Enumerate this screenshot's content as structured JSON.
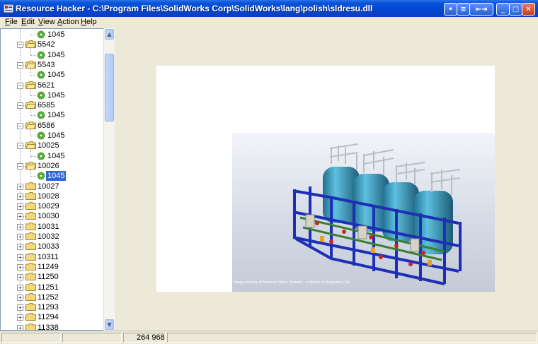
{
  "window": {
    "title": "Resource Hacker   -   C:\\Program Files\\SolidWorks Corp\\SolidWorks\\lang\\polish\\sldresu.dll"
  },
  "menu": [
    {
      "label": "File",
      "accel": "F",
      "rest": "ile"
    },
    {
      "label": "Edit",
      "accel": "E",
      "rest": "dit"
    },
    {
      "label": "View",
      "accel": "V",
      "rest": "iew"
    },
    {
      "label": "Action",
      "accel": "A",
      "rest": "ction"
    },
    {
      "label": "Help",
      "accel": "H",
      "rest": "elp"
    }
  ],
  "tree": {
    "rows": [
      {
        "type": "leaf",
        "label": "1045"
      },
      {
        "type": "folder",
        "label": "5542",
        "expanded": true
      },
      {
        "type": "leaf",
        "label": "1045"
      },
      {
        "type": "folder",
        "label": "5543",
        "expanded": true
      },
      {
        "type": "leaf",
        "label": "1045"
      },
      {
        "type": "folder",
        "label": "5621",
        "expanded": true
      },
      {
        "type": "leaf",
        "label": "1045"
      },
      {
        "type": "folder",
        "label": "6585",
        "expanded": true
      },
      {
        "type": "leaf",
        "label": "1045"
      },
      {
        "type": "folder",
        "label": "6586",
        "expanded": true
      },
      {
        "type": "leaf",
        "label": "1045"
      },
      {
        "type": "folder",
        "label": "10025",
        "expanded": true
      },
      {
        "type": "leaf",
        "label": "1045"
      },
      {
        "type": "folder",
        "label": "10026",
        "expanded": true
      },
      {
        "type": "leaf",
        "label": "1045",
        "selected": true
      },
      {
        "type": "folder",
        "label": "10027",
        "expanded": false
      },
      {
        "type": "folder",
        "label": "10028",
        "expanded": false
      },
      {
        "type": "folder",
        "label": "10029",
        "expanded": false
      },
      {
        "type": "folder",
        "label": "10030",
        "expanded": false
      },
      {
        "type": "folder",
        "label": "10031",
        "expanded": false
      },
      {
        "type": "folder",
        "label": "10032",
        "expanded": false
      },
      {
        "type": "folder",
        "label": "10033",
        "expanded": false
      },
      {
        "type": "folder",
        "label": "10311",
        "expanded": false
      },
      {
        "type": "folder",
        "label": "11249",
        "expanded": false
      },
      {
        "type": "folder",
        "label": "11250",
        "expanded": false
      },
      {
        "type": "folder",
        "label": "11251",
        "expanded": false
      },
      {
        "type": "folder",
        "label": "11252",
        "expanded": false
      },
      {
        "type": "folder",
        "label": "11293",
        "expanded": false
      },
      {
        "type": "folder",
        "label": "11294",
        "expanded": false
      },
      {
        "type": "folder",
        "label": "11338",
        "expanded": false
      }
    ]
  },
  "preview": {
    "caption": "Image courtesy of Anderson Water Systems - a division of Degremont, SA"
  },
  "status": {
    "size": "264 968"
  },
  "colors": {
    "titlebar": "#0a55d8",
    "selection": "#316ac5",
    "tank": "#2e8fb0",
    "frame": "#1d2fb5"
  }
}
